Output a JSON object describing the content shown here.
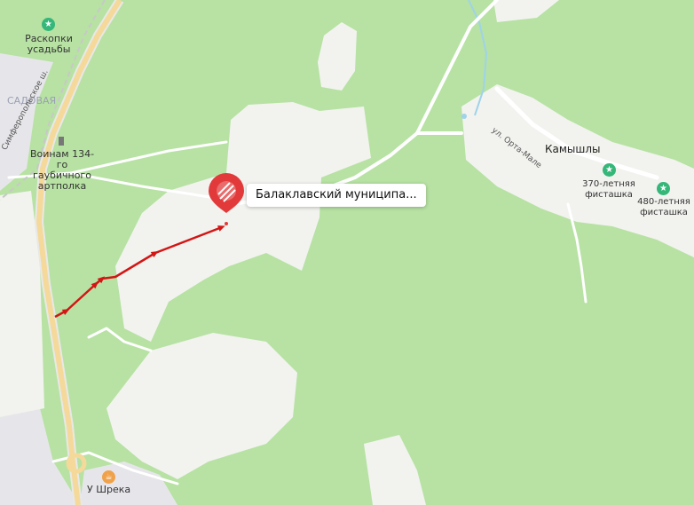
{
  "map": {
    "colors": {
      "forest": "#b7e2a3",
      "clearing": "#f2f3ef",
      "built_area": "#e6e6ea",
      "road": "#ffffff",
      "highway": "#f4d99a",
      "water": "#9fd3ea",
      "route": "#d31515",
      "pin": "#e23a3a",
      "poi_green": "#34b779",
      "poi_orange": "#f0a24a"
    },
    "pin": {
      "label": "Балаклавский муниципа...",
      "icon": "hatched-circle-icon"
    },
    "places": [
      {
        "name": "Раскопки\nусадьбы",
        "icon": "star-icon"
      },
      {
        "name": "САДОВАЯ"
      },
      {
        "name": "Симферопольское ш."
      },
      {
        "name": "Воинам 134-\nго гаубичного\nартполка",
        "icon": "monument-icon"
      },
      {
        "name": "ул. Орта-Мале"
      },
      {
        "name": "Камышлы"
      },
      {
        "name": "370-летняя\nфисташка",
        "icon": "star-icon"
      },
      {
        "name": "480-летняя\nфисташка",
        "icon": "star-icon"
      },
      {
        "name": "У Шрека",
        "icon": "cafe-icon"
      }
    ]
  }
}
